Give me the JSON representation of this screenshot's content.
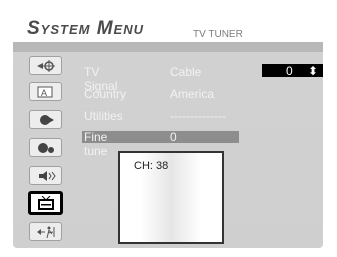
{
  "header": {
    "title": "System Menu",
    "subtitle": "TV TUNER"
  },
  "sidebar": {
    "items": [
      {
        "icon": "target-icon"
      },
      {
        "icon": "language-icon"
      },
      {
        "icon": "play-icon"
      },
      {
        "icon": "shuffle-icon"
      },
      {
        "icon": "speaker-icon"
      },
      {
        "icon": "tv-icon",
        "selected": true
      },
      {
        "icon": "exit-icon"
      }
    ]
  },
  "settings": {
    "tv_signal": {
      "label": "TV Signal",
      "value": "Cable"
    },
    "country": {
      "label": "Country",
      "value": "America"
    },
    "utilities": {
      "label": "Utilities",
      "value": "--------------"
    },
    "fine_tune": {
      "label": "Fine tune",
      "value": "0"
    }
  },
  "spinner": {
    "value": "0",
    "arrows": "⬍"
  },
  "preview": {
    "channel": "CH: 38"
  }
}
